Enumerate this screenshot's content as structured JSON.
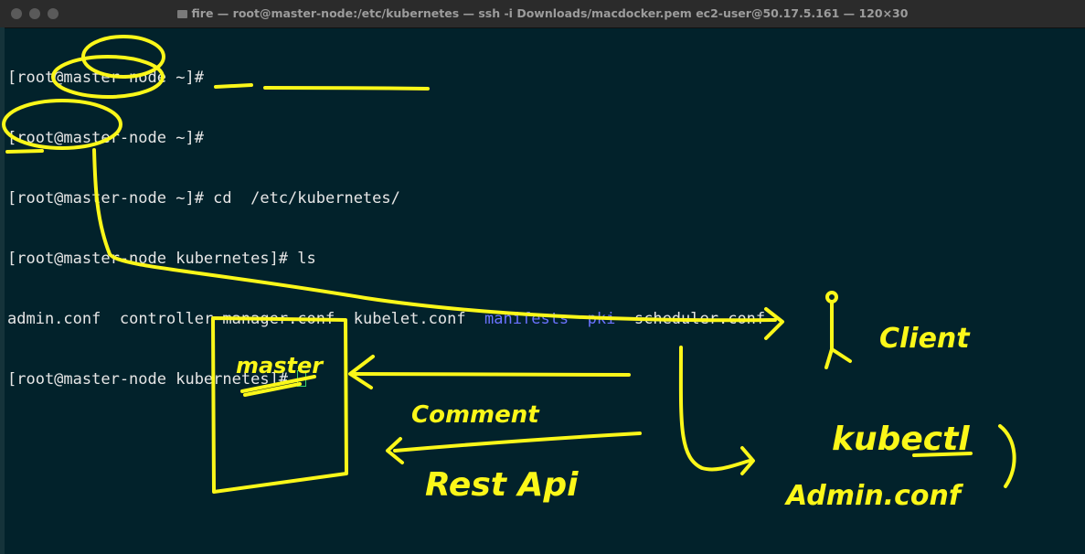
{
  "window": {
    "title": "fire — root@master-node:/etc/kubernetes — ssh -i Downloads/macdocker.pem ec2-user@50.17.5.161 — 120×30",
    "title_icon": "folder-icon"
  },
  "terminal": {
    "lines": [
      {
        "prompt": "[root@master-node ~]# ",
        "command": ""
      },
      {
        "prompt": "[root@master-node ~]# ",
        "command": ""
      },
      {
        "prompt": "[root@master-node ~]# ",
        "command": "cd  /etc/kubernetes/"
      },
      {
        "prompt": "[root@master-node kubernetes]# ",
        "command": "ls"
      }
    ],
    "ls_output": {
      "f1": "admin.conf",
      "f2": "controller-manager.conf",
      "f3": "kubelet.conf",
      "d1": "manifests",
      "d2": "pki",
      "f4": "scheduler.conf"
    },
    "last_prompt": "[root@master-node kubernetes]# ",
    "colors": {
      "background": "#02222b",
      "text": "#e6e6e6",
      "directory": "#6b72ff",
      "cursor": "#3ad26c"
    }
  },
  "annotations": {
    "color": "#fbf719",
    "master": "master",
    "client": "Client",
    "comment": "Comment",
    "rest_api": "Rest Api",
    "kubectl": "kubectl",
    "admin_conf": "Admin.conf"
  }
}
